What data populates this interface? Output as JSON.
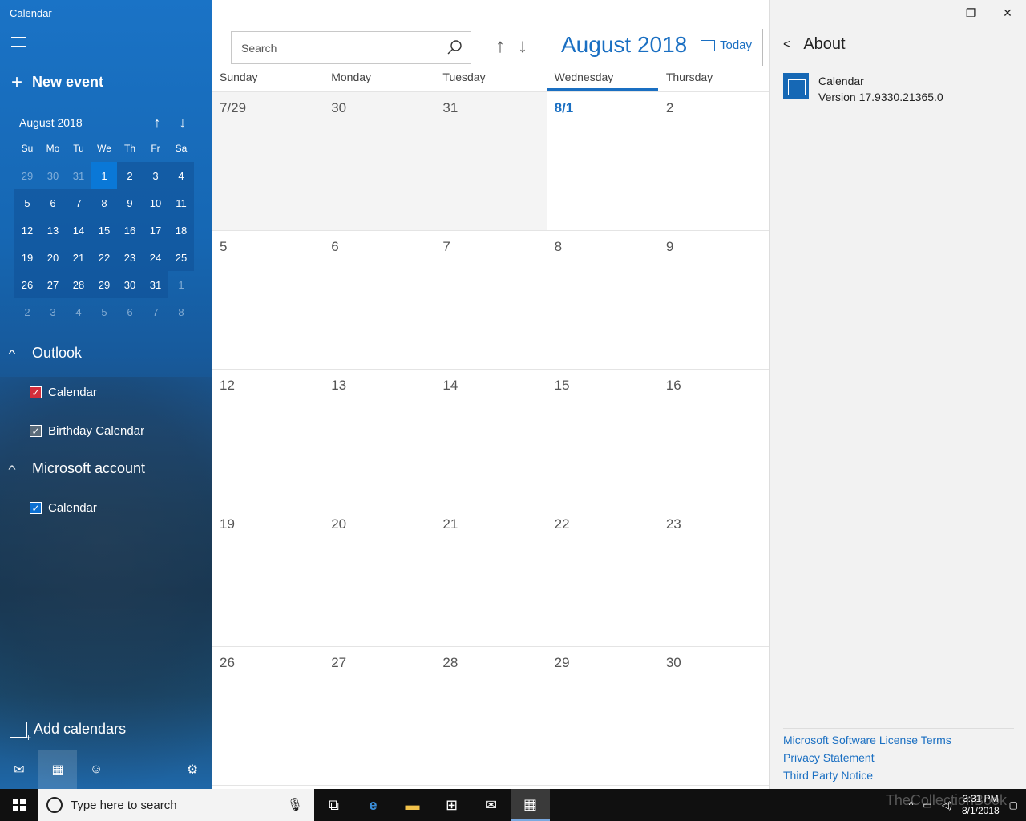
{
  "app": {
    "title": "Calendar"
  },
  "sidebar": {
    "new_event": "New event",
    "mini_calendar": {
      "title": "August 2018",
      "days_of_week": [
        "Su",
        "Mo",
        "Tu",
        "We",
        "Th",
        "Fr",
        "Sa"
      ],
      "days": [
        {
          "label": "29",
          "type": "out"
        },
        {
          "label": "30",
          "type": "out"
        },
        {
          "label": "31",
          "type": "out"
        },
        {
          "label": "1",
          "type": "today"
        },
        {
          "label": "2",
          "type": "in"
        },
        {
          "label": "3",
          "type": "in"
        },
        {
          "label": "4",
          "type": "in"
        },
        {
          "label": "5",
          "type": "in"
        },
        {
          "label": "6",
          "type": "in"
        },
        {
          "label": "7",
          "type": "in"
        },
        {
          "label": "8",
          "type": "in"
        },
        {
          "label": "9",
          "type": "in"
        },
        {
          "label": "10",
          "type": "in"
        },
        {
          "label": "11",
          "type": "in"
        },
        {
          "label": "12",
          "type": "in"
        },
        {
          "label": "13",
          "type": "in"
        },
        {
          "label": "14",
          "type": "in"
        },
        {
          "label": "15",
          "type": "in"
        },
        {
          "label": "16",
          "type": "in"
        },
        {
          "label": "17",
          "type": "in"
        },
        {
          "label": "18",
          "type": "in"
        },
        {
          "label": "19",
          "type": "in"
        },
        {
          "label": "20",
          "type": "in"
        },
        {
          "label": "21",
          "type": "in"
        },
        {
          "label": "22",
          "type": "in"
        },
        {
          "label": "23",
          "type": "in"
        },
        {
          "label": "24",
          "type": "in"
        },
        {
          "label": "25",
          "type": "in"
        },
        {
          "label": "26",
          "type": "in"
        },
        {
          "label": "27",
          "type": "in"
        },
        {
          "label": "28",
          "type": "in"
        },
        {
          "label": "29",
          "type": "in"
        },
        {
          "label": "30",
          "type": "in"
        },
        {
          "label": "31",
          "type": "in"
        },
        {
          "label": "1",
          "type": "out"
        },
        {
          "label": "2",
          "type": "out"
        },
        {
          "label": "3",
          "type": "out"
        },
        {
          "label": "4",
          "type": "out"
        },
        {
          "label": "5",
          "type": "out"
        },
        {
          "label": "6",
          "type": "out"
        },
        {
          "label": "7",
          "type": "out"
        },
        {
          "label": "8",
          "type": "out"
        }
      ]
    },
    "groups": {
      "outlook": {
        "label": "Outlook",
        "calendars": [
          {
            "label": "Calendar",
            "color": "#d32d3b"
          },
          {
            "label": "Birthday Calendar",
            "color": "#5a6b7a"
          }
        ]
      },
      "microsoft": {
        "label": "Microsoft account",
        "calendars": [
          {
            "label": "Calendar",
            "color": "#0b6fd1"
          }
        ]
      }
    },
    "add_calendars": "Add calendars"
  },
  "main": {
    "search_placeholder": "Search",
    "month_title": "August 2018",
    "today_label": "Today",
    "columns": [
      "Sunday",
      "Monday",
      "Tuesday",
      "Wednesday",
      "Thursday"
    ],
    "weeks": [
      [
        {
          "label": "7/29",
          "type": "prev"
        },
        {
          "label": "30",
          "type": "prev"
        },
        {
          "label": "31",
          "type": "prev"
        },
        {
          "label": "8/1",
          "type": "today"
        },
        {
          "label": "2",
          "type": "cur"
        }
      ],
      [
        {
          "label": "5",
          "type": "cur"
        },
        {
          "label": "6",
          "type": "cur"
        },
        {
          "label": "7",
          "type": "cur"
        },
        {
          "label": "8",
          "type": "cur"
        },
        {
          "label": "9",
          "type": "cur"
        }
      ],
      [
        {
          "label": "12",
          "type": "cur"
        },
        {
          "label": "13",
          "type": "cur"
        },
        {
          "label": "14",
          "type": "cur"
        },
        {
          "label": "15",
          "type": "cur"
        },
        {
          "label": "16",
          "type": "cur"
        }
      ],
      [
        {
          "label": "19",
          "type": "cur"
        },
        {
          "label": "20",
          "type": "cur"
        },
        {
          "label": "21",
          "type": "cur"
        },
        {
          "label": "22",
          "type": "cur"
        },
        {
          "label": "23",
          "type": "cur"
        }
      ],
      [
        {
          "label": "26",
          "type": "cur"
        },
        {
          "label": "27",
          "type": "cur"
        },
        {
          "label": "28",
          "type": "cur"
        },
        {
          "label": "29",
          "type": "cur"
        },
        {
          "label": "30",
          "type": "cur"
        }
      ]
    ]
  },
  "about": {
    "title": "About",
    "app_name": "Calendar",
    "version": "Version 17.9330.21365.0",
    "links": [
      "Microsoft Software License Terms",
      "Privacy Statement",
      "Third Party Notice"
    ]
  },
  "taskbar": {
    "search_placeholder": "Type here to search",
    "time": "3:31 PM",
    "date": "8/1/2018",
    "watermark": "TheCollectionBook",
    "apps": [
      "task-view-icon",
      "edge-icon",
      "file-explorer-icon",
      "store-icon",
      "mail-icon",
      "calendar-icon"
    ]
  },
  "colors": {
    "accent": "#1a6fc2",
    "sidebar": "#1667b3",
    "today": "#0a78d7"
  }
}
